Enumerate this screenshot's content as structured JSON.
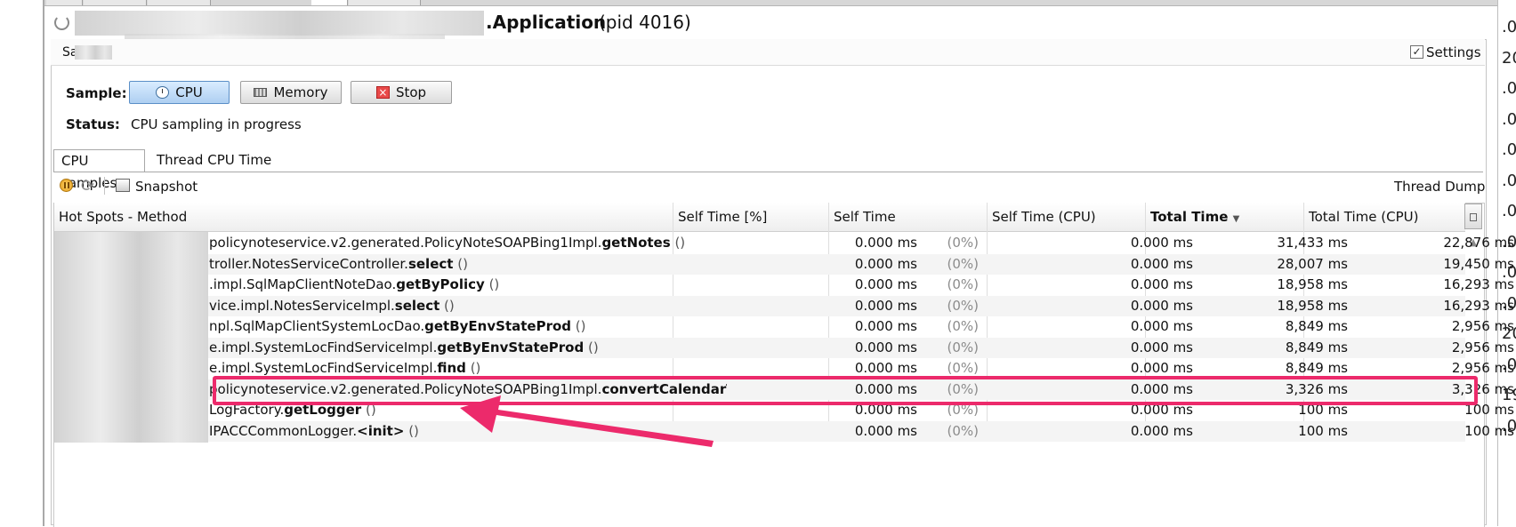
{
  "window": {
    "app_title": ".Application",
    "pid_label": "(pid 4016)"
  },
  "sampler": {
    "header_label": "Sa",
    "settings_checked": true,
    "settings_label": "Settings",
    "sample_label": "Sample:",
    "buttons": [
      {
        "label": "CPU",
        "icon": "cpu-gauge-icon",
        "active": true
      },
      {
        "label": "Memory",
        "icon": "memory-chip-icon",
        "active": false
      },
      {
        "label": "Stop",
        "icon": "stop-icon",
        "active": false
      }
    ],
    "status_label": "Status:",
    "status_value": "CPU sampling in progress"
  },
  "tabs": [
    {
      "label": "CPU samples",
      "selected": true
    },
    {
      "label": "Thread CPU Time",
      "selected": false
    }
  ],
  "toolbar": {
    "snapshot_label": "Snapshot",
    "thread_dump_label": "Thread Dump"
  },
  "table": {
    "columns": [
      "Hot Spots - Method",
      "Self Time [%]",
      "Self Time",
      "Self Time (CPU)",
      "Total Time",
      "Total Time (CPU)"
    ],
    "sorted_column": "Total Time",
    "sort_direction": "descending",
    "rows": [
      {
        "prefix": "policynoteservice.v2.generated.PolicyNoteSOAPBing1Impl.",
        "method": "getNotes",
        "args": "()",
        "self_time": "0.000 ms",
        "self_pct": "(0%)",
        "self_cpu": "0.000 ms",
        "total": "31,433 ms",
        "total_cpu": "22,876 ms"
      },
      {
        "prefix": "troller.NotesServiceController.",
        "method": "select",
        "args": "()",
        "self_time": "0.000 ms",
        "self_pct": "(0%)",
        "self_cpu": "0.000 ms",
        "total": "28,007 ms",
        "total_cpu": "19,450 ms"
      },
      {
        "prefix": ".impl.SqlMapClientNoteDao.",
        "method": "getByPolicy",
        "args": "()",
        "self_time": "0.000 ms",
        "self_pct": "(0%)",
        "self_cpu": "0.000 ms",
        "total": "18,958 ms",
        "total_cpu": "16,293 ms"
      },
      {
        "prefix": "vice.impl.NotesServiceImpl.",
        "method": "select",
        "args": "()",
        "self_time": "0.000 ms",
        "self_pct": "(0%)",
        "self_cpu": "0.000 ms",
        "total": "18,958 ms",
        "total_cpu": "16,293 ms"
      },
      {
        "prefix": "npl.SqlMapClientSystemLocDao.",
        "method": "getByEnvStateProd",
        "args": "()",
        "self_time": "0.000 ms",
        "self_pct": "(0%)",
        "self_cpu": "0.000 ms",
        "total": "8,849 ms",
        "total_cpu": "2,956 ms"
      },
      {
        "prefix": "e.impl.SystemLocFindServiceImpl.",
        "method": "getByEnvStateProd",
        "args": "()",
        "self_time": "0.000 ms",
        "self_pct": "(0%)",
        "self_cpu": "0.000 ms",
        "total": "8,849 ms",
        "total_cpu": "2,956 ms"
      },
      {
        "prefix": "e.impl.SystemLocFindServiceImpl.",
        "method": "find",
        "args": "()",
        "self_time": "0.000 ms",
        "self_pct": "(0%)",
        "self_cpu": "0.000 ms",
        "total": "8,849 ms",
        "total_cpu": "2,956 ms"
      },
      {
        "prefix": "policynoteservice.v2.generated.PolicyNoteSOAPBing1Impl.",
        "method": "convertCalendarT",
        "args": "",
        "self_time": "0.000 ms",
        "self_pct": "(0%)",
        "self_cpu": "0.000 ms",
        "total": "3,326 ms",
        "total_cpu": "3,326 ms"
      },
      {
        "prefix": "LogFactory.",
        "method": "getLogger",
        "args": "()",
        "self_time": "0.000 ms",
        "self_pct": "(0%)",
        "self_cpu": "0.000 ms",
        "total": "100 ms",
        "total_cpu": "100 ms"
      },
      {
        "prefix": "IPACCCommonLogger.",
        "method": "<init>",
        "args": "()",
        "self_time": "0.000 ms",
        "self_pct": "(0%)",
        "self_cpu": "0.000 ms",
        "total": "100 ms",
        "total_cpu": "100 ms"
      }
    ]
  },
  "right_gutter_chars": [
    ".0",
    "20",
    ".0",
    ".0",
    ".0",
    ".0",
    ".0",
    ".0",
    ".0",
    ".0",
    "20",
    ".0",
    "19",
    ".0"
  ],
  "annotation": {
    "color": "#ec2a6b",
    "highlighted_row": 7
  }
}
